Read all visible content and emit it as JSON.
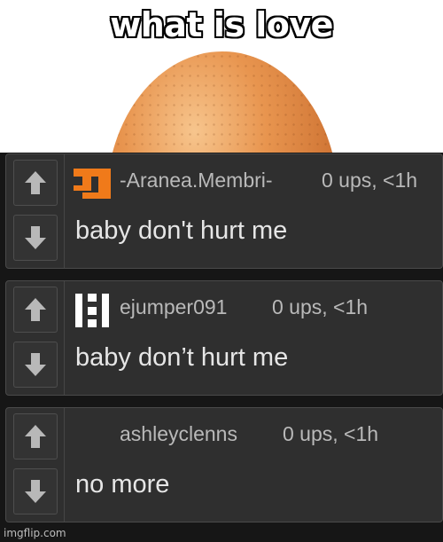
{
  "meme": {
    "title": "what is love"
  },
  "comments": [
    {
      "author": "-Aranea.Membri-",
      "score": "0 ups, <1h",
      "text": "baby don't hurt me",
      "avatar_color": "#f07a1a",
      "avatar_icon": "orange-pixel-avatar-icon"
    },
    {
      "author": "ejumper091",
      "score": "0 ups, <1h",
      "text": "baby don’t hurt me",
      "avatar_color": "#ffffff",
      "avatar_icon": "white-pixel-avatar-icon"
    },
    {
      "author": "ashleyclenns",
      "score": "0 ups, <1h",
      "text": "no more",
      "avatar_color": "",
      "avatar_icon": ""
    }
  ],
  "watermark": "imgflip.com",
  "colors": {
    "panel": "#2f2f2f",
    "border": "#4a4a4a",
    "arrow": "#b8b8b8",
    "text": "#e6e6e6",
    "meta": "#b9b9b9"
  },
  "icons": {
    "upvote": "up-arrow-icon",
    "downvote": "down-arrow-icon"
  }
}
